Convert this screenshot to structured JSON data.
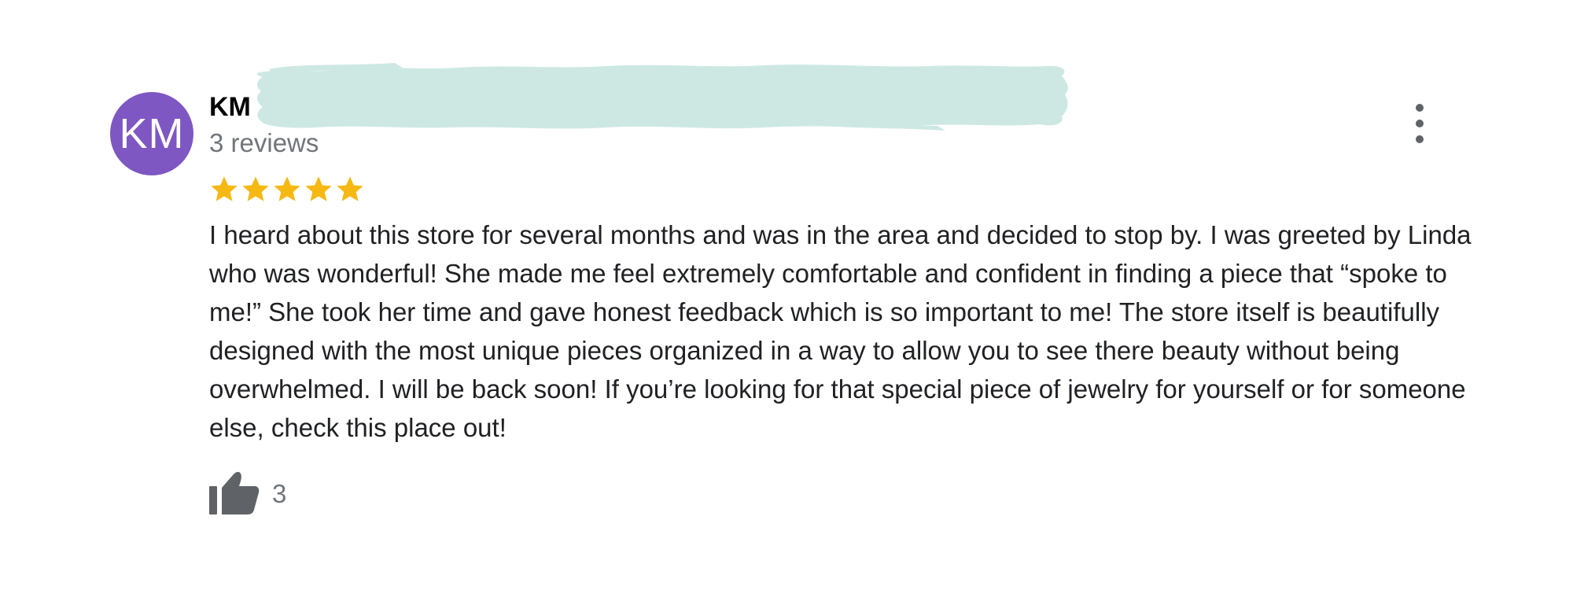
{
  "reviewer": {
    "initials": "KM",
    "name": "KM",
    "review_count": "3 reviews",
    "avatar_color": "#7e57c2"
  },
  "rating": {
    "stars": 5,
    "max": 5,
    "star_color": "#f6b913"
  },
  "review": {
    "text": "I heard about this store for several months and was in the area and decided to stop by. I was greeted by Linda who was wonderful! She made me feel extremely comfortable and confident in finding a piece that “spoke to me!” She took her time and gave honest feedback which is so important to me! The store itself is beautifully designed with the most unique pieces organized in a way to allow you to see there beauty without being overwhelmed. I will be back soon! If you’re looking for that special piece of jewelry for yourself or for someone else, check this place out!"
  },
  "actions": {
    "like_count": "3",
    "like_icon": "thumbs-up-icon",
    "more_icon": "more-vertical-icon"
  },
  "colors": {
    "icon_gray": "#5f6368",
    "secondary_text": "#70757a",
    "redaction": "#cde8e3"
  }
}
